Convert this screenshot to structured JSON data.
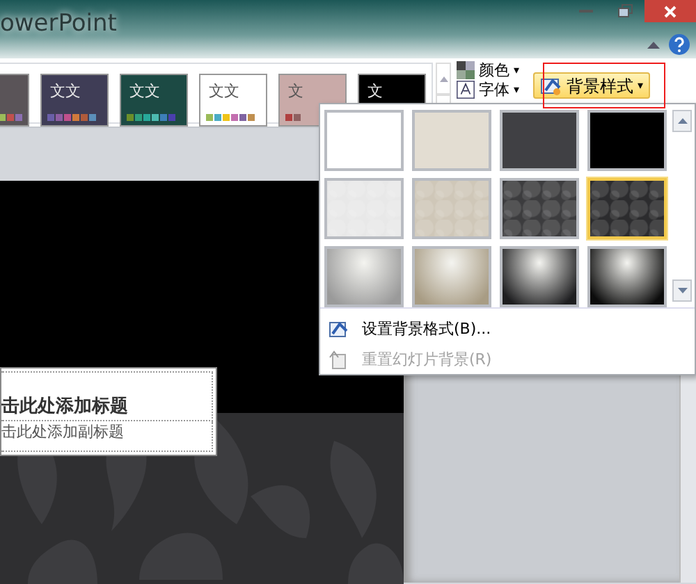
{
  "window": {
    "title": "owerPoint"
  },
  "themes": [
    {
      "color": "#5a5458",
      "swatches": [
        {
          "color": "#9bbb59"
        },
        {
          "color": "#c0504d"
        },
        {
          "color": "#8b6fb0"
        }
      ]
    },
    {
      "label": "文文",
      "color": "#3f3d56",
      "swatches": [
        {
          "color": "#6a5fa8"
        },
        {
          "color": "#8e5ea2"
        },
        {
          "color": "#c0508c"
        },
        {
          "color": "#d07a3c"
        },
        {
          "color": "#b05b3b"
        },
        {
          "color": "#5b8fb9"
        }
      ]
    },
    {
      "label": "文文",
      "color": "#1c4a44",
      "swatches": [
        {
          "color": "#6b8f2a"
        },
        {
          "color": "#2e9f7e"
        },
        {
          "color": "#27a99a"
        },
        {
          "color": "#4dbab0"
        },
        {
          "color": "#3d7fb8"
        },
        {
          "color": "#4a3fae"
        }
      ]
    },
    {
      "label": "文文",
      "color": "#ffffff",
      "swatches": [
        {
          "color": "#9bbb59"
        },
        {
          "color": "#4bacc6"
        },
        {
          "color": "#f0c419"
        },
        {
          "color": "#c36fb0"
        },
        {
          "color": "#8064a2"
        },
        {
          "color": "#c09050"
        }
      ]
    },
    {
      "label": "文",
      "color": "#c9aaa8",
      "swatches": [
        {
          "color": "#b04040"
        },
        {
          "color": "#8e6060"
        }
      ]
    },
    {
      "label": "文",
      "color": "#000000"
    }
  ],
  "design_commands": [
    {
      "label": "颜色",
      "caret": "▾"
    },
    {
      "label": "字体",
      "caret": "▾"
    }
  ],
  "background_styles_button": {
    "label": "背景样式",
    "caret": "▾"
  },
  "background_styles": [
    {
      "kind": "plain",
      "color": "#ffffff",
      "selected": false
    },
    {
      "kind": "plain",
      "color": "#e3ddd2",
      "selected": false
    },
    {
      "kind": "plain",
      "color": "#404044",
      "selected": false
    },
    {
      "kind": "plain",
      "color": "#000000",
      "selected": false
    },
    {
      "kind": "pattern",
      "color": "#e8e8e8",
      "selected": false
    },
    {
      "kind": "pattern",
      "color": "#cfc7b8",
      "selected": false
    },
    {
      "kind": "pattern",
      "color": "#3c3c3e",
      "selected": false
    },
    {
      "kind": "pattern",
      "color": "#2c2c2e",
      "selected": true
    },
    {
      "kind": "gradient",
      "color": "#9a9a9a",
      "selected": false
    },
    {
      "kind": "gradient",
      "color": "#a89c84",
      "selected": false
    },
    {
      "kind": "gradient",
      "color": "#1e1e20",
      "selected": false
    },
    {
      "kind": "gradient",
      "color": "#0c0c0c",
      "selected": false
    }
  ],
  "menu_items": [
    {
      "label": "设置背景格式(B)...",
      "disabled": false
    },
    {
      "label": "重置幻灯片背景(R)",
      "disabled": true
    }
  ],
  "slide": {
    "title_placeholder": "击此处添加标题",
    "subtitle_placeholder": "击此处添加副标题"
  }
}
